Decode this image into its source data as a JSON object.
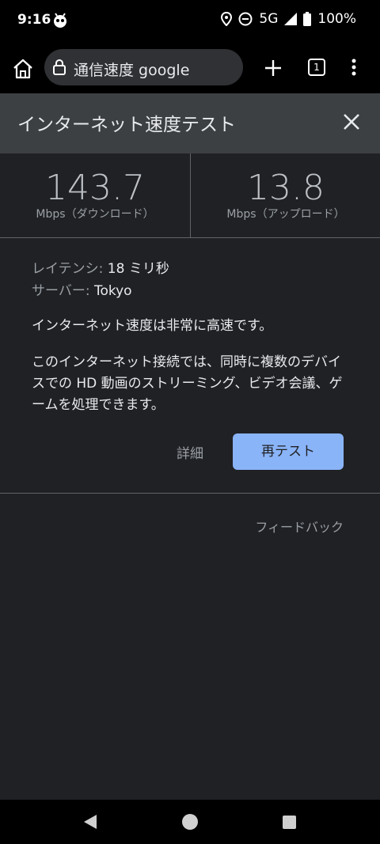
{
  "status_bar": {
    "time": "9:16",
    "network": "5G",
    "battery": "100%",
    "icons": [
      "app-notification-icon",
      "location-icon",
      "do-not-disturb-icon",
      "signal-icon",
      "battery-icon"
    ]
  },
  "browser": {
    "address_text": "通信速度 google",
    "tab_count": "1",
    "icons": [
      "home-icon",
      "lock-icon",
      "plus-icon",
      "tab-switcher-icon",
      "more-vert-icon"
    ]
  },
  "speedtest": {
    "title": "インターネット速度テスト",
    "download": {
      "value": "143.7",
      "label": "Mbps（ダウンロード）"
    },
    "upload": {
      "value": "13.8",
      "label": "Mbps（アップロード）"
    },
    "latency": {
      "key": "レイテンシ:",
      "value": " 18 ミリ秒"
    },
    "server": {
      "key": "サーバー:",
      "value": " Tokyo"
    },
    "summary": "インターネット速度は非常に高速です。",
    "description": "このインターネット接続では、同時に複数のデバイスでの HD 動画のストリーミング、ビデオ会議、ゲームを処理できます。",
    "details_label": "詳細",
    "retest_label": "再テスト",
    "feedback_label": "フィードバック"
  },
  "colors": {
    "accent": "#8ab4f8",
    "background": "#202124",
    "header": "#3c4043"
  }
}
